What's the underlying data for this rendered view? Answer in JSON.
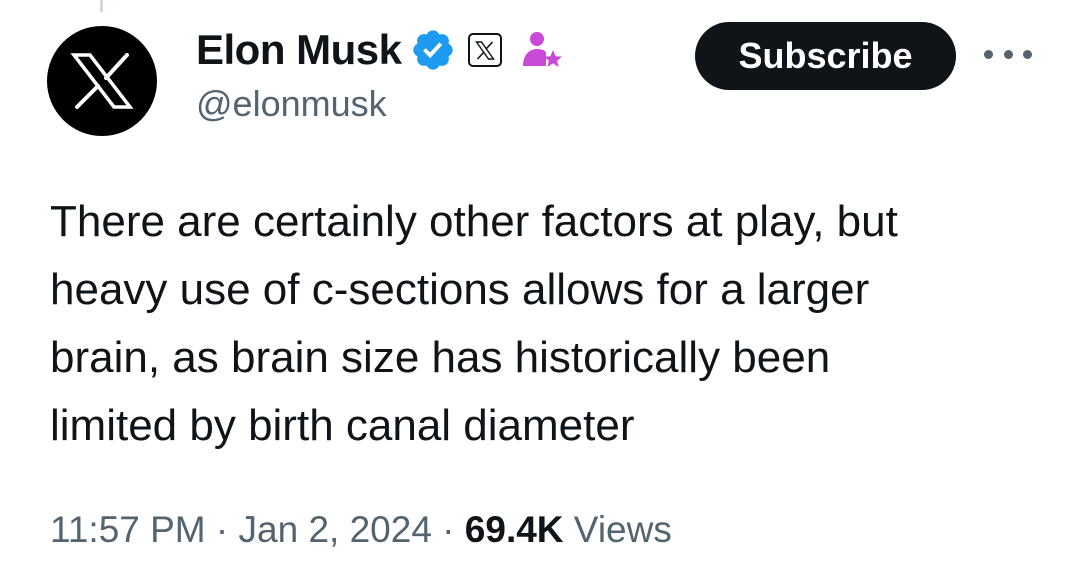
{
  "author": {
    "display_name": "Elon Musk",
    "handle": "@elonmusk",
    "avatar_icon": "x-logo-icon",
    "badges": [
      "verified-badge-icon",
      "x-affiliation-icon",
      "creator-subscription-icon"
    ]
  },
  "actions": {
    "subscribe_label": "Subscribe",
    "more_icon": "more-options-icon"
  },
  "tweet": {
    "lines": [
      "There are certainly other factors at play, but",
      "heavy use of c-sections allows for a larger",
      "brain, as brain size has historically been",
      "limited by birth canal diameter"
    ]
  },
  "meta": {
    "time": "11:57 PM",
    "separator": " · ",
    "date": "Jan 2, 2024",
    "views_count": "69.4K",
    "views_label": " Views"
  },
  "colors": {
    "text_primary": "#0f1419",
    "text_secondary": "#536471",
    "verified_blue": "#1d9bf0",
    "creator_pink": "#c94ad6"
  }
}
